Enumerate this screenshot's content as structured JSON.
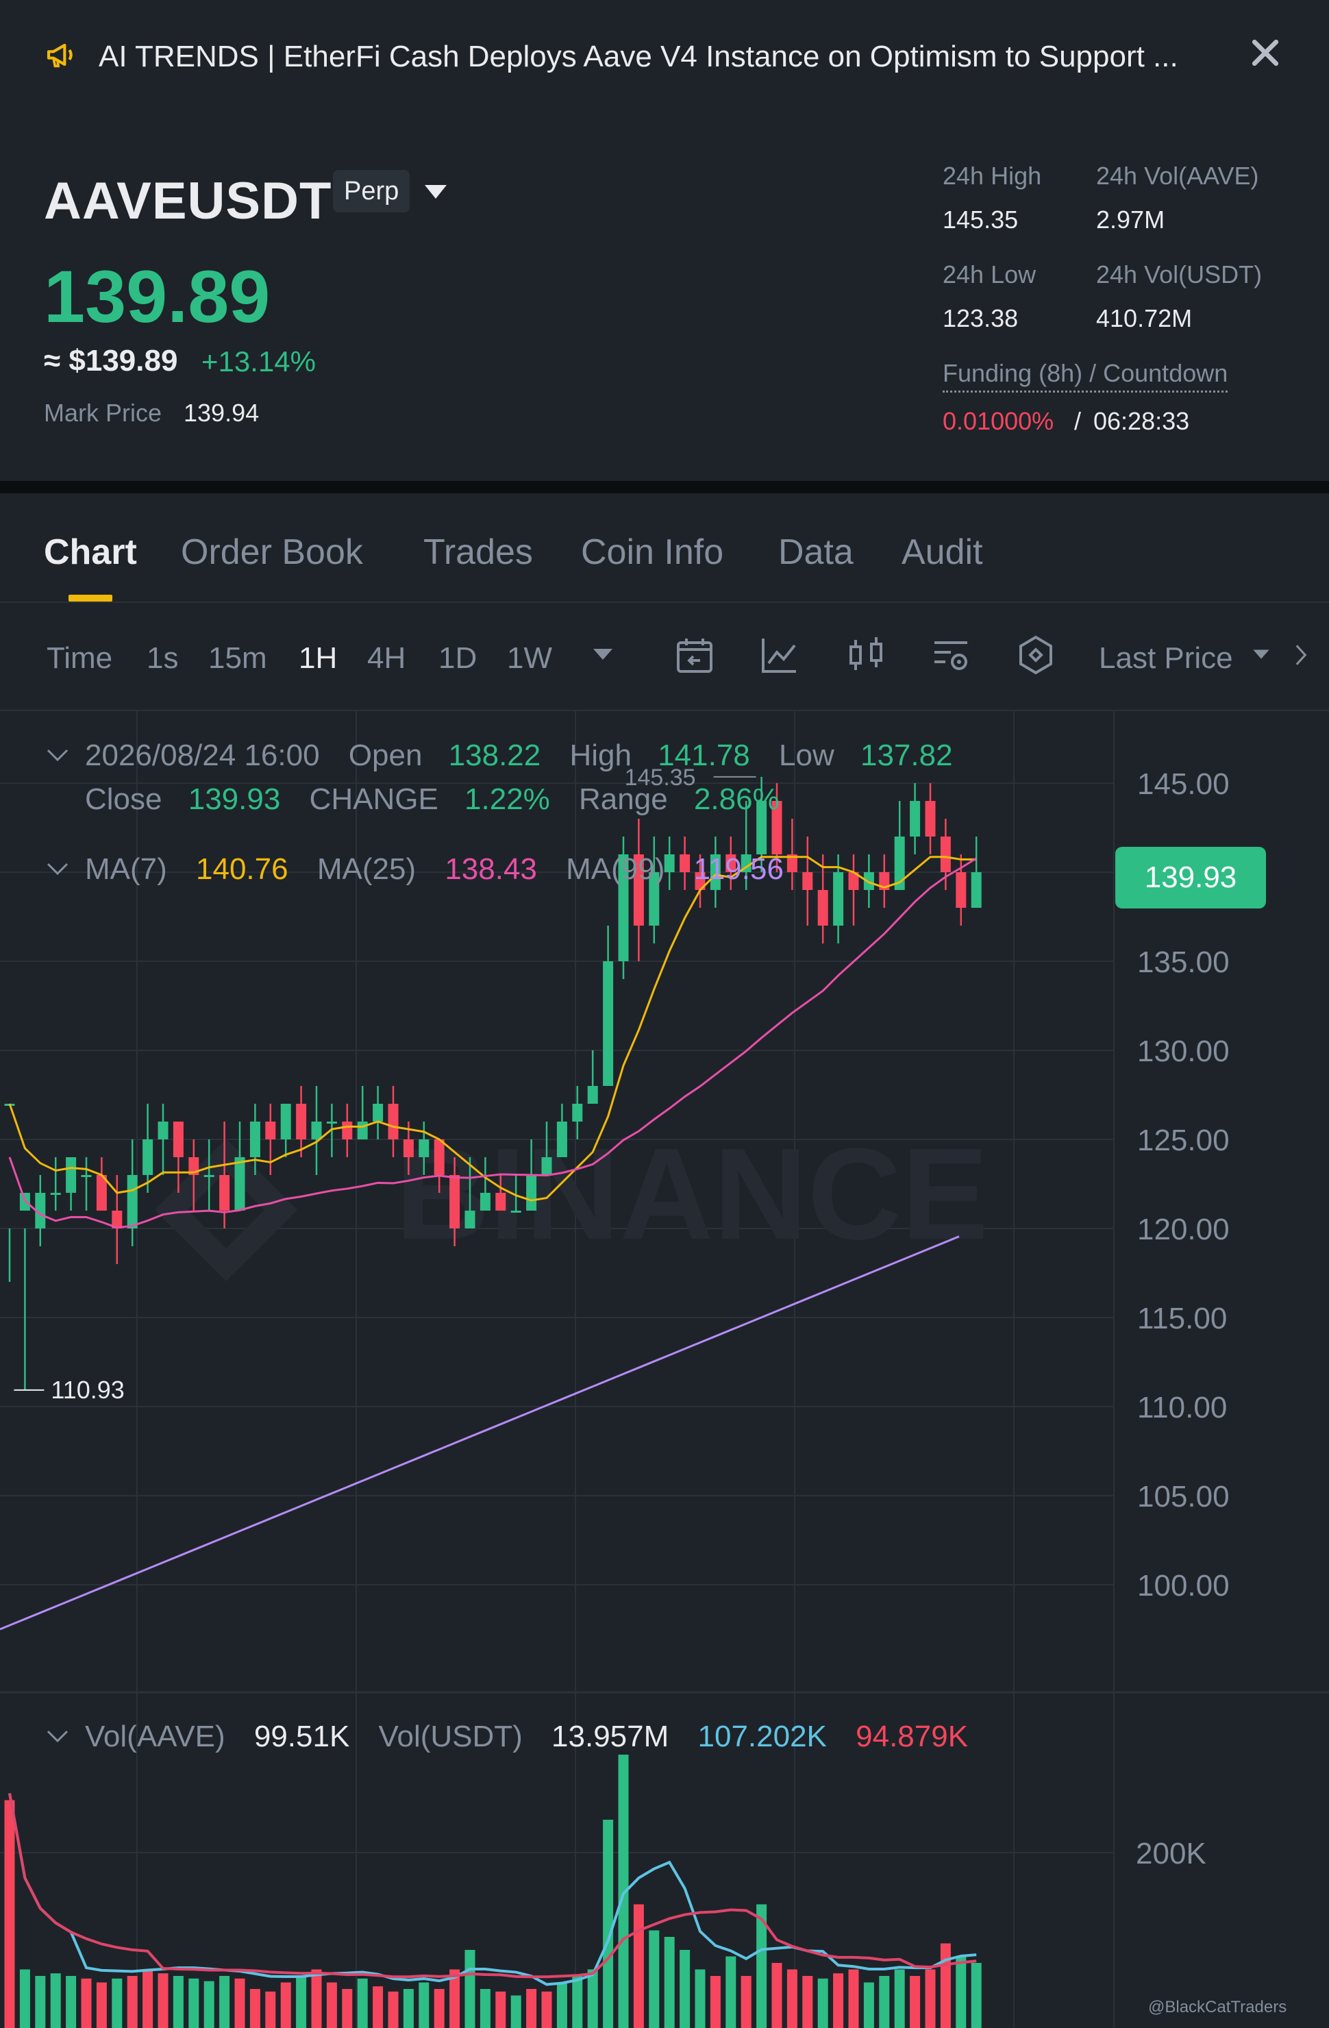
{
  "announcement": {
    "icon": "megaphone-icon",
    "text": "AI TRENDS | EtherFi Cash Deploys Aave V4 Instance on Optimism to Support ...",
    "close_icon": "close-icon"
  },
  "header": {
    "symbol": "AAVEUSDT",
    "contract_type": "Perp",
    "last_price": "139.89",
    "usd_price": "≈ $139.89",
    "change_pct": "+13.14%",
    "mark_price_label": "Mark Price",
    "mark_price": "139.94",
    "stats": {
      "high_label": "24h High",
      "high": "145.35",
      "vol_base_label": "24h Vol(AAVE)",
      "vol_base": "2.97M",
      "low_label": "24h Low",
      "low": "123.38",
      "vol_quote_label": "24h Vol(USDT)",
      "vol_quote": "410.72M",
      "funding_label": "Funding (8h) / Countdown",
      "funding_rate": "0.01000%",
      "funding_sep": "/",
      "countdown": "06:28:33"
    }
  },
  "tabs": [
    "Chart",
    "Order Book",
    "Trades",
    "Coin Info",
    "Data",
    "Audit"
  ],
  "toolbar": {
    "time_label": "Time",
    "intervals": [
      "1s",
      "15m",
      "1H",
      "4H",
      "1D",
      "1W"
    ],
    "active_interval": "1H",
    "price_type": "Last Price"
  },
  "legend": {
    "datetime": "2026/08/24 16:00",
    "open_label": "Open",
    "open": "138.22",
    "high_label": "High",
    "high": "141.78",
    "low_label": "Low",
    "low": "137.82",
    "close_label": "Close",
    "close": "139.93",
    "change_label": "CHANGE",
    "change": "1.22%",
    "range_label": "Range",
    "range": "2.86%",
    "ma7_label": "MA(7)",
    "ma7": "140.76",
    "ma25_label": "MA(25)",
    "ma25": "138.43",
    "ma99_label": "MA(99)",
    "ma99": "119.56",
    "vol_base_label": "Vol(AAVE)",
    "vol_base": "99.51K",
    "vol_quote_label": "Vol(USDT)",
    "vol_quote": "13.957M",
    "vol_ma1": "107.202K",
    "vol_ma2": "94.879K"
  },
  "colors": {
    "up": "#2ebd85",
    "down": "#f6465d",
    "ma7": "#f0b90b",
    "ma25": "#e84fa8",
    "ma99": "#b58cf5",
    "vol_ma1": "#5fc3e4",
    "vol_ma2": "#e0456a",
    "accent": "#f0b90b"
  },
  "chart_data": {
    "type": "candlestick",
    "price_axis_ticks": [
      "145.00",
      "135.00",
      "130.00",
      "125.00",
      "120.00",
      "115.00",
      "110.00",
      "105.00",
      "100.00"
    ],
    "volume_axis_ticks": [
      "200K"
    ],
    "ylim": [
      96,
      148
    ],
    "current_price": "139.93",
    "max_marker": "145.35",
    "min_marker": "110.93",
    "watermark": "BINANCE",
    "credit": "@BlackCatTraders",
    "candles": [
      [
        127,
        127,
        120,
        117
      ],
      [
        121,
        122,
        120,
        110.93
      ],
      [
        120,
        122,
        123,
        119
      ],
      [
        122,
        122,
        124,
        121
      ],
      [
        122,
        124,
        124,
        121
      ],
      [
        123,
        123,
        124,
        121
      ],
      [
        123,
        121,
        124,
        121
      ],
      [
        121,
        120,
        123,
        118
      ],
      [
        120,
        123,
        125,
        119
      ],
      [
        123,
        125,
        127,
        122
      ],
      [
        125,
        126,
        127,
        123
      ],
      [
        126,
        124,
        126,
        122
      ],
      [
        124,
        123,
        125,
        121
      ],
      [
        123,
        123,
        125,
        121
      ],
      [
        123,
        121,
        126,
        120
      ],
      [
        121,
        124,
        126,
        121
      ],
      [
        124,
        126,
        127,
        123
      ],
      [
        126,
        125,
        127,
        123
      ],
      [
        125,
        127,
        127,
        124
      ],
      [
        127,
        125,
        128,
        124
      ],
      [
        125,
        126,
        128,
        123
      ],
      [
        126,
        126,
        127,
        124
      ],
      [
        126,
        125,
        127,
        124
      ],
      [
        125,
        126,
        128,
        125
      ],
      [
        126,
        127,
        128,
        125
      ],
      [
        127,
        125,
        128,
        124
      ],
      [
        125,
        124,
        126,
        123
      ],
      [
        124,
        125,
        126,
        123
      ],
      [
        125,
        123,
        125,
        122
      ],
      [
        123,
        120,
        124,
        119
      ],
      [
        120,
        121,
        124,
        120
      ],
      [
        121,
        122,
        124,
        121
      ],
      [
        122,
        121,
        123,
        121
      ],
      [
        121,
        121,
        123,
        121
      ],
      [
        121,
        123,
        125,
        121
      ],
      [
        123,
        124,
        126,
        123
      ],
      [
        124,
        126,
        127,
        124
      ],
      [
        126,
        127,
        128,
        125
      ],
      [
        127,
        128,
        130,
        127
      ],
      [
        128,
        135,
        137,
        128
      ],
      [
        135,
        141,
        142,
        134
      ],
      [
        141,
        137,
        143,
        135
      ],
      [
        137,
        140,
        142,
        136
      ],
      [
        140,
        141,
        142,
        139
      ],
      [
        141,
        140,
        142,
        139
      ],
      [
        140,
        139,
        141,
        138
      ],
      [
        139,
        141,
        142,
        138
      ],
      [
        141,
        140,
        142,
        139
      ],
      [
        140,
        141,
        144,
        139
      ],
      [
        141,
        144,
        145.35,
        140
      ],
      [
        144,
        141,
        145,
        140
      ],
      [
        141,
        140,
        143,
        139
      ],
      [
        140,
        139,
        142,
        137
      ],
      [
        139,
        137,
        141,
        136
      ],
      [
        137,
        140,
        141,
        136
      ],
      [
        140,
        139,
        141,
        137
      ],
      [
        139,
        140,
        141,
        138
      ],
      [
        140,
        139,
        141,
        138
      ],
      [
        139,
        142,
        144,
        139
      ],
      [
        142,
        144,
        145,
        141
      ],
      [
        144,
        142,
        145,
        141
      ],
      [
        142,
        140,
        143,
        139
      ],
      [
        140,
        138,
        141,
        137
      ],
      [
        138,
        140,
        142,
        138
      ]
    ],
    "volumes": [
      [
        175,
        0
      ],
      [
        45,
        1
      ],
      [
        40,
        1
      ],
      [
        42,
        1
      ],
      [
        40,
        1
      ],
      [
        38,
        0
      ],
      [
        35,
        0
      ],
      [
        38,
        1
      ],
      [
        40,
        0
      ],
      [
        45,
        0
      ],
      [
        42,
        0
      ],
      [
        40,
        1
      ],
      [
        38,
        1
      ],
      [
        36,
        1
      ],
      [
        40,
        1
      ],
      [
        38,
        0
      ],
      [
        30,
        0
      ],
      [
        28,
        0
      ],
      [
        35,
        0
      ],
      [
        40,
        1
      ],
      [
        45,
        0
      ],
      [
        35,
        0
      ],
      [
        30,
        0
      ],
      [
        38,
        1
      ],
      [
        32,
        0
      ],
      [
        28,
        0
      ],
      [
        30,
        1
      ],
      [
        35,
        1
      ],
      [
        30,
        0
      ],
      [
        45,
        0
      ],
      [
        60,
        1
      ],
      [
        30,
        1
      ],
      [
        28,
        0
      ],
      [
        25,
        1
      ],
      [
        30,
        0
      ],
      [
        28,
        0
      ],
      [
        35,
        1
      ],
      [
        40,
        1
      ],
      [
        45,
        1
      ],
      [
        160,
        1
      ],
      [
        210,
        1
      ],
      [
        95,
        0
      ],
      [
        75,
        1
      ],
      [
        70,
        1
      ],
      [
        60,
        1
      ],
      [
        45,
        1
      ],
      [
        40,
        0
      ],
      [
        55,
        1
      ],
      [
        40,
        0
      ],
      [
        95,
        1
      ],
      [
        50,
        0
      ],
      [
        45,
        0
      ],
      [
        40,
        0
      ],
      [
        38,
        1
      ],
      [
        42,
        0
      ],
      [
        45,
        0
      ],
      [
        35,
        1
      ],
      [
        40,
        1
      ],
      [
        45,
        1
      ],
      [
        40,
        0
      ],
      [
        45,
        0
      ],
      [
        65,
        0
      ],
      [
        55,
        1
      ],
      [
        50,
        1
      ]
    ]
  }
}
